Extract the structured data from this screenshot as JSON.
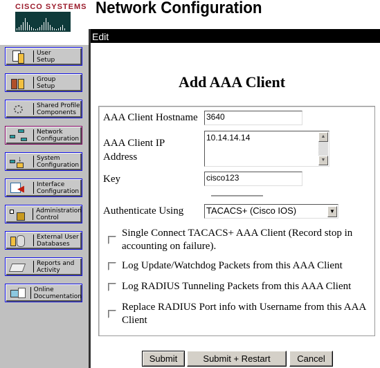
{
  "logo": {
    "text": "Cisco Systems"
  },
  "header": {
    "title": "Network Configuration",
    "section": "Edit"
  },
  "sidebar": {
    "items": [
      {
        "label": "User\nSetup",
        "icon": "user-icon"
      },
      {
        "label": "Group\nSetup",
        "icon": "group-icon"
      },
      {
        "label": "Shared Profile\nComponents",
        "icon": "gears-icon"
      },
      {
        "label": "Network\nConfiguration",
        "icon": "network-icon",
        "active": true
      },
      {
        "label": "System\nConfiguration",
        "icon": "system-icon"
      },
      {
        "label": "Interface\nConfiguration",
        "icon": "interface-icon"
      },
      {
        "label": "Administration\nControl",
        "icon": "lock-icon"
      },
      {
        "label": "External User\nDatabases",
        "icon": "database-icon"
      },
      {
        "label": "Reports and\nActivity",
        "icon": "reports-icon"
      },
      {
        "label": "Online\nDocumentation",
        "icon": "documentation-icon"
      }
    ]
  },
  "form": {
    "heading": "Add AAA Client",
    "hostname_label": "AAA Client Hostname",
    "hostname": "3640",
    "ip_label": "AAA Client IP Address",
    "ip": "10.14.14.14",
    "key_label": "Key",
    "key": "cisco123",
    "auth_label": "Authenticate Using",
    "auth_value": "TACACS+ (Cisco IOS)",
    "checkboxes": [
      {
        "label": "Single Connect TACACS+ AAA Client (Record stop in accounting on failure).",
        "checked": false
      },
      {
        "label": "Log Update/Watchdog Packets from this AAA Client",
        "checked": false
      },
      {
        "label": "Log RADIUS Tunneling Packets from this AAA Client",
        "checked": false
      },
      {
        "label": "Replace RADIUS Port info with Username from this AAA Client",
        "checked": false
      }
    ]
  },
  "buttons": {
    "submit": "Submit",
    "submit_restart": "Submit + Restart",
    "cancel": "Cancel"
  },
  "colors": {
    "nav_border": "#1010e0",
    "nav_active_border": "#800060",
    "logo_red": "#9b1c2c",
    "logo_teal": "#0f3a3a"
  }
}
